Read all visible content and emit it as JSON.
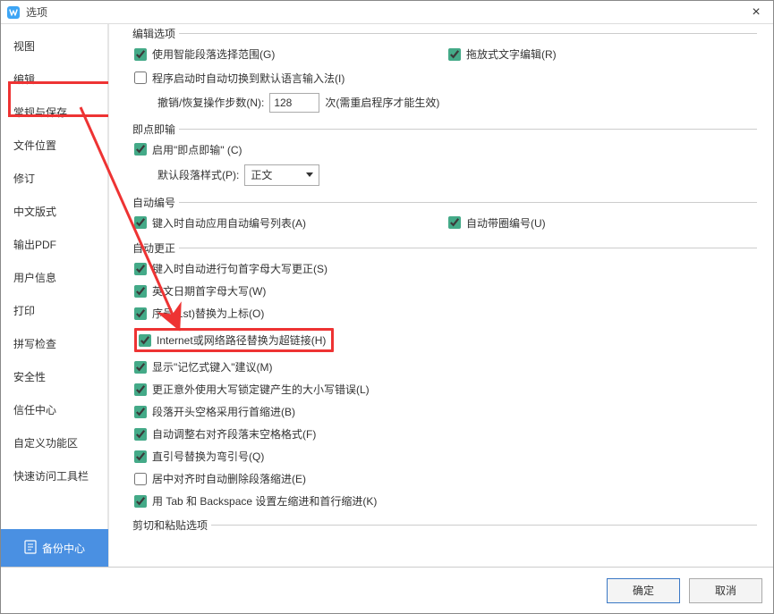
{
  "window": {
    "title": "选项"
  },
  "sidebar": {
    "items": [
      {
        "label": "视图"
      },
      {
        "label": "编辑"
      },
      {
        "label": "常规与保存"
      },
      {
        "label": "文件位置"
      },
      {
        "label": "修订"
      },
      {
        "label": "中文版式"
      },
      {
        "label": "输出PDF"
      },
      {
        "label": "用户信息"
      },
      {
        "label": "打印"
      },
      {
        "label": "拼写检查"
      },
      {
        "label": "安全性"
      },
      {
        "label": "信任中心"
      },
      {
        "label": "自定义功能区"
      },
      {
        "label": "快速访问工具栏"
      }
    ],
    "active_index": 1
  },
  "groups": {
    "edit": {
      "title": "编辑选项",
      "smart_para": "使用智能段落选择范围(G)",
      "drag_edit": "拖放式文字编辑(R)",
      "auto_ime": "程序启动时自动切换到默认语言输入法(I)",
      "undo_label": "撤销/恢复操作步数(N):",
      "undo_value": "128",
      "undo_suffix": "次(需重启程序才能生效)"
    },
    "click_type": {
      "title": "即点即输",
      "enable": "启用\"即点即输\" (C)",
      "default_style_label": "默认段落样式(P):",
      "default_style_value": "正文"
    },
    "auto_num": {
      "title": "自动编号",
      "apply_list": "键入时自动应用自动编号列表(A)",
      "circle_num": "自动带圈编号(U)"
    },
    "auto_correct": {
      "title": "自动更正",
      "items": [
        {
          "label": "键入时自动进行句首字母大写更正(S)",
          "checked": true
        },
        {
          "label": "英文日期首字母大写(W)",
          "checked": true
        },
        {
          "label": "序号(1st)替换为上标(O)",
          "checked": true
        },
        {
          "label": "Internet或网络路径替换为超链接(H)",
          "checked": true,
          "hl": true
        },
        {
          "label": "显示\"记忆式键入\"建议(M)",
          "checked": true
        },
        {
          "label": "更正意外使用大写锁定键产生的大小写错误(L)",
          "checked": true
        },
        {
          "label": "段落开头空格采用行首缩进(B)",
          "checked": true
        },
        {
          "label": "自动调整右对齐段落末空格格式(F)",
          "checked": true
        },
        {
          "label": "直引号替换为弯引号(Q)",
          "checked": true
        },
        {
          "label": "居中对齐时自动删除段落缩进(E)",
          "checked": false
        },
        {
          "label": "用 Tab 和 Backspace 设置左缩进和首行缩进(K)",
          "checked": true
        }
      ]
    },
    "clip": {
      "title": "剪切和粘贴选项"
    }
  },
  "footer": {
    "backup": "备份中心",
    "ok": "确定",
    "cancel": "取消"
  }
}
